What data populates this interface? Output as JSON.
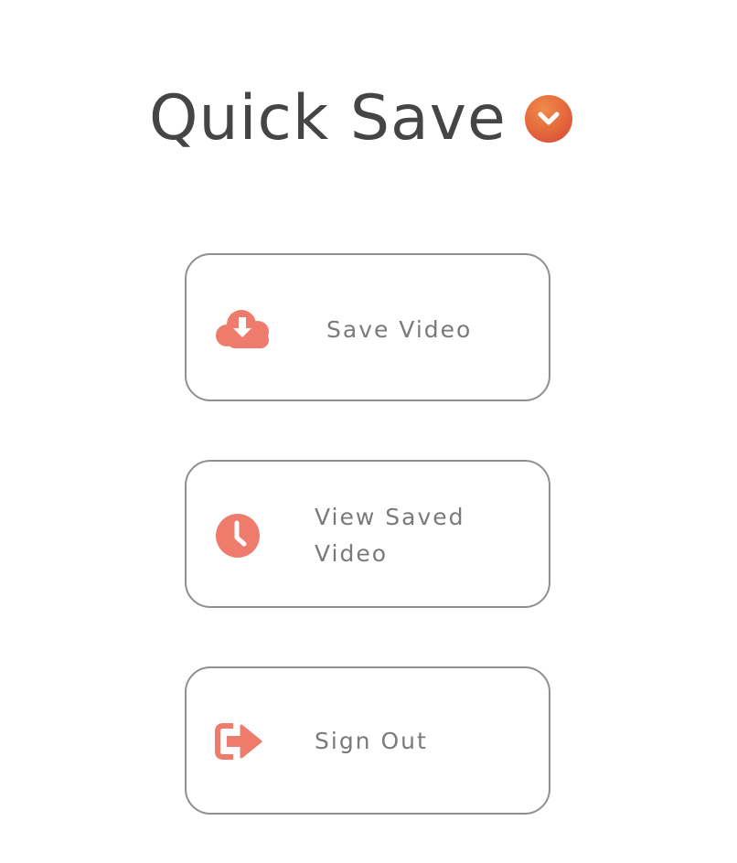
{
  "app": {
    "title": "Quick Save",
    "logo_icon": "chevron-down-circle-icon",
    "brand_color": "#e5623e"
  },
  "menu": {
    "accent_color": "#ef7b6d",
    "items": [
      {
        "label": "Save Video",
        "icon": "cloud-download-icon"
      },
      {
        "label": "View Saved Video",
        "icon": "clock-icon"
      },
      {
        "label": "Sign Out",
        "icon": "sign-out-icon"
      }
    ]
  }
}
